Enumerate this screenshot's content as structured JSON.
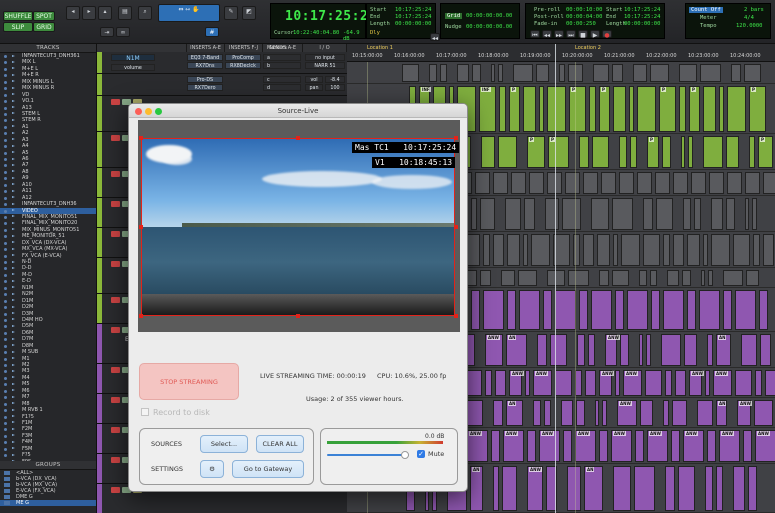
{
  "toolbar": {
    "modes": [
      "SHUFFLE",
      "SPOT",
      "SLIP",
      "GRID"
    ],
    "main_counter": "10:17:25:24",
    "cursor_label": "Cursor",
    "cursor_value": "10:22:40:04.80",
    "db_value": "-64.9 dB",
    "dly_label": "Dly",
    "sel": {
      "labels": [
        "Start",
        "End",
        "Length"
      ],
      "values": [
        "10:17:25:24",
        "10:17:25:24",
        "00:00:00:00"
      ]
    },
    "grid": {
      "grid_label": "Grid",
      "grid_value": "00:00:00:00.00",
      "nudge_label": "Nudge",
      "nudge_value": "00:00:00:00.00"
    },
    "roll": {
      "labels": [
        "Pre-roll",
        "Post-roll",
        "Fade-in"
      ],
      "values": [
        "00:00:10:00",
        "00:00:04:00",
        "00:00:250"
      ]
    },
    "roll_sel_values": [
      "10:17:25:24",
      "10:17:25:24",
      "00:00:00:00"
    ],
    "count": {
      "label": "Count Off",
      "bars": "2 bars",
      "meter_label": "Meter",
      "meter_value": "4/4",
      "tempo_label": "Tempo",
      "tempo_value": "120.0000"
    }
  },
  "tracks_panel": {
    "title": "TRACKS",
    "items": [
      "INFANTECUT3_DNH361",
      "MIX L",
      "M+E L",
      "M+E R",
      "MIX MINUS L",
      "MIX MINUS R",
      "VD",
      "VO.1",
      "A13",
      "STEM L",
      "STEM R",
      "A1",
      "A2",
      "A3",
      "A4",
      "A5",
      "A6",
      "A7",
      "A8",
      "A9",
      "A10",
      "A11",
      "A12",
      "INFANTECUT3_DNH36",
      "VIDEO",
      "FINAL_MIX_MONITO51",
      "FINAL_MIX_MONITO20",
      "MIX_MINUS_MONITO51",
      "ME_MONITOR_51",
      "DX_VCA (DX-VCA)",
      "MX_VCA (MX-VCA)",
      "FX_VCA (E-VCA)",
      "N-D",
      "D-D",
      "M-D",
      "E-D",
      "N1M",
      "N2M",
      "D1M",
      "D2M",
      "D3M",
      "D4M HO",
      "D5M",
      "D6M",
      "D7M",
      "D8M",
      "M SUB",
      "M1",
      "M2",
      "M3",
      "M4",
      "M5",
      "M6",
      "M7",
      "M8",
      "M RVB 1",
      "F1?5",
      "F1M",
      "F2M",
      "F3M",
      "F4M",
      "F5M",
      "F?5",
      "F9S",
      "F10S",
      "F12S",
      "F13S",
      "F14S",
      "F15S",
      "FX RVB 1",
      "M SUB M",
      "FINAL MIX - MASTER",
      "MIX MINUS - MASTER"
    ],
    "selected_index": 24
  },
  "groups_panel": {
    "title": "GROUPS",
    "items": [
      "<ALL>",
      "b-VCA (DX_VCA)",
      "b-VCA (MX_VCA)",
      "E-VCA (FX_VCA)",
      "DME G",
      "ME G"
    ],
    "selected_index": 5
  },
  "strips": {
    "headers": [
      "INSERTS A-E",
      "INSERTS F-J",
      "SENDS A-E",
      "I / O"
    ],
    "track_name": "N1M",
    "volume_label": "volume",
    "slots_a": [
      "EQ3 7-Band",
      "RX7Dns",
      "Pro-DS",
      "RX7Dero"
    ],
    "slots_b": [
      "ProComp",
      "RX8Declck"
    ],
    "sends": [
      "a",
      "b",
      "c",
      "d"
    ],
    "io": [
      "no input",
      "NARR 51"
    ],
    "vol_label": "vol",
    "vol_value": "-8.4",
    "pan_label": "pan",
    "pan_value": "100",
    "row_marker": "E"
  },
  "edit": {
    "markers_label": "Markers",
    "timecode_label": "Timecode",
    "locations": [
      "Location 1",
      "Location 2"
    ],
    "ruler_times": [
      "10:15:00:00",
      "10:16:00:00",
      "10:17:00:00",
      "10:18:00:00",
      "10:19:00:00",
      "10:20:00:00",
      "10:21:00:00",
      "10:22:00:00",
      "10:23:00:00",
      "10:24:00:00"
    ],
    "clip_labels": {
      "inf": "INF",
      "p": "P",
      "anw": "ANW",
      "an": "AN",
      "ai": "AI"
    }
  },
  "source_live": {
    "title": "Source-Live",
    "tc_top_label": "Mas TC1",
    "tc_top_value": "10:17:25:24",
    "tc_bottom_label": "V1",
    "tc_bottom_value": "10:18:45:13",
    "stop_button": "STOP STREAMING",
    "live_time_label": "LIVE STREAMING TIME: 00:00:19",
    "cpu_label": "CPU: 10.6%, 25.00 fp",
    "usage_label": "Usage: 2 of 355 viewer hours.",
    "record_label": "Record to disk",
    "sources_label": "SOURCES",
    "select_button": "Select...",
    "clear_button": "CLEAR ALL",
    "settings_label": "SETTINGS",
    "gateway_button": "Go to Gateway",
    "meter_db": "0.0 dB",
    "mute_label": "Mute",
    "mute_checked": true,
    "volume_level": 0.95
  }
}
